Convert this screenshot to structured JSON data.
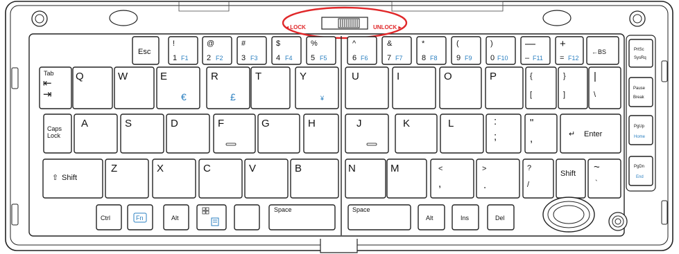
{
  "lock_switch": {
    "lock": "◂ LOCK",
    "unlock": "UNLOCK ▸"
  },
  "keys": {
    "esc": "Esc",
    "f1_top": "!",
    "f1_main": "1",
    "f1_fn": "F1",
    "f2_top": "@",
    "f2_main": "2",
    "f2_fn": "F2",
    "f3_top": "#",
    "f3_main": "3",
    "f3_fn": "F3",
    "f4_top": "$",
    "f4_main": "4",
    "f4_fn": "F4",
    "f5_top": "%",
    "f5_main": "5",
    "f5_fn": "F5",
    "f6_top": "^",
    "f6_main": "6",
    "f6_fn": "F6",
    "f7_top": "&",
    "f7_main": "7",
    "f7_fn": "F7",
    "f8_top": "*",
    "f8_main": "8",
    "f8_fn": "F8",
    "f9_top": "(",
    "f9_main": "9",
    "f9_fn": "F9",
    "f10_top": ")",
    "f10_main": "0",
    "f10_fn": "F10",
    "f11_top": "—",
    "f11_main": "–",
    "f11_fn": "F11",
    "f12_top": "+",
    "f12_main": "=",
    "f12_fn": "F12",
    "backspace": "←BS",
    "tab": "Tab",
    "tab_arrows": "⇤\n⇥",
    "q": "Q",
    "w": "W",
    "e": "E",
    "e_alt": "€",
    "r": "R",
    "r_alt": "£",
    "t": "T",
    "y": "Y",
    "y_alt": "¥",
    "u": "U",
    "i": "I",
    "o": "O",
    "p": "P",
    "lbrace_top": "{",
    "lbrace_bot": "[",
    "rbrace_top": "}",
    "rbrace_bot": "]",
    "pipe_top": "|",
    "pipe_bot": "\\",
    "caps": "Caps",
    "caps2": "Lock",
    "a": "A",
    "s": "S",
    "d": "D",
    "f": "F",
    "g": "G",
    "h": "H",
    "j": "J",
    "k": "K",
    "l": "L",
    "colon_top": ":",
    "colon_bot": ";",
    "quote_top": "\"",
    "quote_bot": ",",
    "enter": "Enter",
    "shift_l": "Shift",
    "z": "Z",
    "x": "X",
    "c": "C",
    "v": "V",
    "b": "B",
    "n": "N",
    "m": "M",
    "lt_top": "<",
    "lt_bot": ",",
    "gt_top": ">",
    "gt_bot": ".",
    "q_top": "?",
    "q_bot": "/",
    "shift_r": "Shift",
    "tilde_top": "~",
    "tilde_bot": "`",
    "ctrl": "Ctrl",
    "fn": "Fn",
    "alt_l": "Alt",
    "space_l": "Space",
    "space_r": "Space",
    "alt_r": "Alt",
    "ins": "Ins",
    "del": "Del",
    "prtsc": "PrtSc",
    "sysrq": "SysRq",
    "pause": "Pause",
    "break": "Break",
    "pgup": "PgUp",
    "home": "Home",
    "pgdn": "PgDn",
    "end": "End"
  },
  "colors": {
    "accent_red": "#e0282a",
    "fn_blue": "#2a7fc0"
  }
}
